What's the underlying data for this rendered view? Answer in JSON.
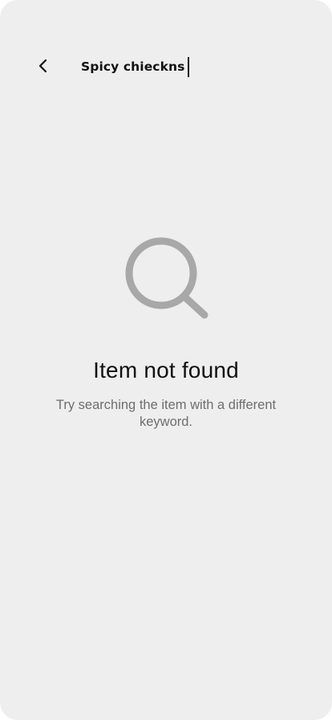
{
  "header": {
    "back_icon": "chevron-left-icon",
    "search_query": "Spicy chieckns"
  },
  "empty_state": {
    "icon": "search-icon",
    "icon_color": "#a8a8a8",
    "title": "Item not found",
    "subtitle": "Try searching the item with a different keyword."
  },
  "colors": {
    "background": "#eeeeee",
    "text_primary": "#111111",
    "text_secondary": "#6e6e6e"
  }
}
